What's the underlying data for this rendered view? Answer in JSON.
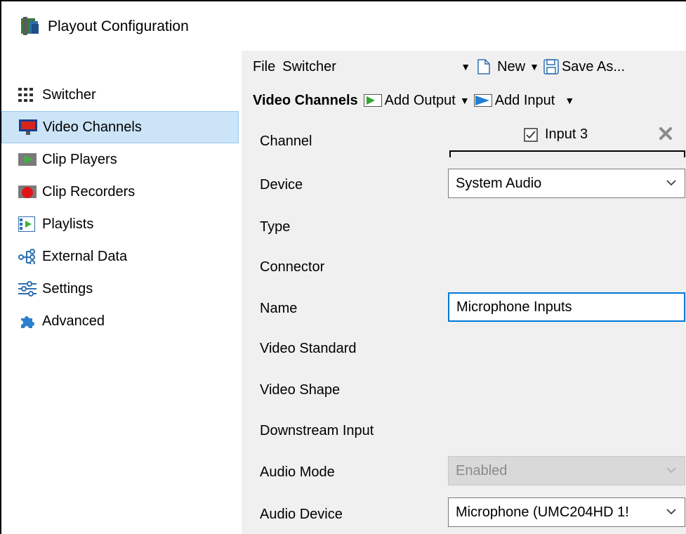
{
  "window": {
    "title": "Playout Configuration"
  },
  "sidebar": {
    "items": [
      {
        "label": "Switcher",
        "icon": "switcher-grid-icon",
        "selected": false
      },
      {
        "label": "Video Channels",
        "icon": "video-monitor-icon",
        "selected": true
      },
      {
        "label": "Clip Players",
        "icon": "clip-player-icon",
        "selected": false
      },
      {
        "label": "Clip Recorders",
        "icon": "record-icon",
        "selected": false
      },
      {
        "label": "Playlists",
        "icon": "playlist-icon",
        "selected": false
      },
      {
        "label": "External Data",
        "icon": "external-data-icon",
        "selected": false
      },
      {
        "label": "Settings",
        "icon": "sliders-icon",
        "selected": false
      },
      {
        "label": "Advanced",
        "icon": "puzzle-icon",
        "selected": false
      }
    ]
  },
  "toolbar": {
    "file_label": "File",
    "file_value": "Switcher",
    "new_label": "New",
    "save_as_label": "Save As..."
  },
  "section": {
    "title": "Video Channels",
    "add_output_label": "Add Output",
    "add_input_label": "Add Input"
  },
  "channel": {
    "tab_label": "Input 3",
    "tab_checked": true
  },
  "fields": {
    "channel_label": "Channel",
    "device_label": "Device",
    "device_value": "System Audio",
    "type_label": "Type",
    "connector_label": "Connector",
    "name_label": "Name",
    "name_value": "Microphone Inputs",
    "video_standard_label": "Video Standard",
    "video_shape_label": "Video Shape",
    "downstream_input_label": "Downstream Input",
    "audio_mode_label": "Audio Mode",
    "audio_mode_value": "Enabled",
    "audio_device_label": "Audio Device",
    "audio_device_value": "Microphone (UMC204HD 1!"
  },
  "colors": {
    "selection": "#cce4f7",
    "panel": "#f0f0f0",
    "focus": "#0078d7"
  }
}
